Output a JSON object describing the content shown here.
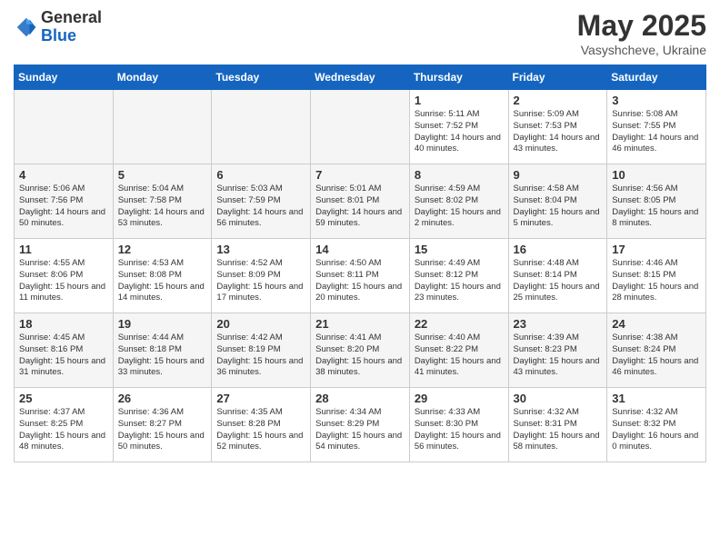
{
  "logo": {
    "general": "General",
    "blue": "Blue"
  },
  "title": "May 2025",
  "subtitle": "Vasyshcheve, Ukraine",
  "weekdays": [
    "Sunday",
    "Monday",
    "Tuesday",
    "Wednesday",
    "Thursday",
    "Friday",
    "Saturday"
  ],
  "weeks": [
    [
      {
        "day": "",
        "empty": true
      },
      {
        "day": "",
        "empty": true
      },
      {
        "day": "",
        "empty": true
      },
      {
        "day": "",
        "empty": true
      },
      {
        "day": "1",
        "sunrise": "5:11 AM",
        "sunset": "7:52 PM",
        "daylight": "14 hours and 40 minutes."
      },
      {
        "day": "2",
        "sunrise": "5:09 AM",
        "sunset": "7:53 PM",
        "daylight": "14 hours and 43 minutes."
      },
      {
        "day": "3",
        "sunrise": "5:08 AM",
        "sunset": "7:55 PM",
        "daylight": "14 hours and 46 minutes."
      }
    ],
    [
      {
        "day": "4",
        "sunrise": "5:06 AM",
        "sunset": "7:56 PM",
        "daylight": "14 hours and 50 minutes."
      },
      {
        "day": "5",
        "sunrise": "5:04 AM",
        "sunset": "7:58 PM",
        "daylight": "14 hours and 53 minutes."
      },
      {
        "day": "6",
        "sunrise": "5:03 AM",
        "sunset": "7:59 PM",
        "daylight": "14 hours and 56 minutes."
      },
      {
        "day": "7",
        "sunrise": "5:01 AM",
        "sunset": "8:01 PM",
        "daylight": "14 hours and 59 minutes."
      },
      {
        "day": "8",
        "sunrise": "4:59 AM",
        "sunset": "8:02 PM",
        "daylight": "15 hours and 2 minutes."
      },
      {
        "day": "9",
        "sunrise": "4:58 AM",
        "sunset": "8:04 PM",
        "daylight": "15 hours and 5 minutes."
      },
      {
        "day": "10",
        "sunrise": "4:56 AM",
        "sunset": "8:05 PM",
        "daylight": "15 hours and 8 minutes."
      }
    ],
    [
      {
        "day": "11",
        "sunrise": "4:55 AM",
        "sunset": "8:06 PM",
        "daylight": "15 hours and 11 minutes."
      },
      {
        "day": "12",
        "sunrise": "4:53 AM",
        "sunset": "8:08 PM",
        "daylight": "15 hours and 14 minutes."
      },
      {
        "day": "13",
        "sunrise": "4:52 AM",
        "sunset": "8:09 PM",
        "daylight": "15 hours and 17 minutes."
      },
      {
        "day": "14",
        "sunrise": "4:50 AM",
        "sunset": "8:11 PM",
        "daylight": "15 hours and 20 minutes."
      },
      {
        "day": "15",
        "sunrise": "4:49 AM",
        "sunset": "8:12 PM",
        "daylight": "15 hours and 23 minutes."
      },
      {
        "day": "16",
        "sunrise": "4:48 AM",
        "sunset": "8:14 PM",
        "daylight": "15 hours and 25 minutes."
      },
      {
        "day": "17",
        "sunrise": "4:46 AM",
        "sunset": "8:15 PM",
        "daylight": "15 hours and 28 minutes."
      }
    ],
    [
      {
        "day": "18",
        "sunrise": "4:45 AM",
        "sunset": "8:16 PM",
        "daylight": "15 hours and 31 minutes."
      },
      {
        "day": "19",
        "sunrise": "4:44 AM",
        "sunset": "8:18 PM",
        "daylight": "15 hours and 33 minutes."
      },
      {
        "day": "20",
        "sunrise": "4:42 AM",
        "sunset": "8:19 PM",
        "daylight": "15 hours and 36 minutes."
      },
      {
        "day": "21",
        "sunrise": "4:41 AM",
        "sunset": "8:20 PM",
        "daylight": "15 hours and 38 minutes."
      },
      {
        "day": "22",
        "sunrise": "4:40 AM",
        "sunset": "8:22 PM",
        "daylight": "15 hours and 41 minutes."
      },
      {
        "day": "23",
        "sunrise": "4:39 AM",
        "sunset": "8:23 PM",
        "daylight": "15 hours and 43 minutes."
      },
      {
        "day": "24",
        "sunrise": "4:38 AM",
        "sunset": "8:24 PM",
        "daylight": "15 hours and 46 minutes."
      }
    ],
    [
      {
        "day": "25",
        "sunrise": "4:37 AM",
        "sunset": "8:25 PM",
        "daylight": "15 hours and 48 minutes."
      },
      {
        "day": "26",
        "sunrise": "4:36 AM",
        "sunset": "8:27 PM",
        "daylight": "15 hours and 50 minutes."
      },
      {
        "day": "27",
        "sunrise": "4:35 AM",
        "sunset": "8:28 PM",
        "daylight": "15 hours and 52 minutes."
      },
      {
        "day": "28",
        "sunrise": "4:34 AM",
        "sunset": "8:29 PM",
        "daylight": "15 hours and 54 minutes."
      },
      {
        "day": "29",
        "sunrise": "4:33 AM",
        "sunset": "8:30 PM",
        "daylight": "15 hours and 56 minutes."
      },
      {
        "day": "30",
        "sunrise": "4:32 AM",
        "sunset": "8:31 PM",
        "daylight": "15 hours and 58 minutes."
      },
      {
        "day": "31",
        "sunrise": "4:32 AM",
        "sunset": "8:32 PM",
        "daylight": "16 hours and 0 minutes."
      }
    ]
  ],
  "labels": {
    "sunrise": "Sunrise:",
    "sunset": "Sunset:",
    "daylight": "Daylight:"
  }
}
